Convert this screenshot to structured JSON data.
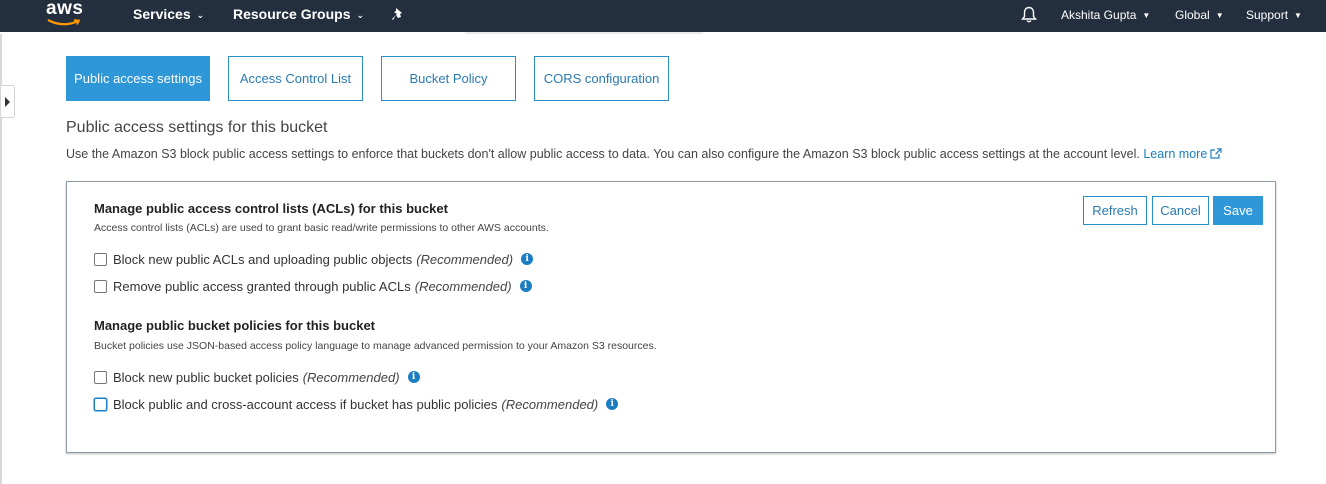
{
  "topnav": {
    "logo_text": "aws",
    "services_label": "Services",
    "resource_groups_label": "Resource Groups",
    "user_label": "Akshita Gupta",
    "region_label": "Global",
    "support_label": "Support",
    "icons": {
      "pin": "pin-icon",
      "bell": "bell-icon",
      "caret": "chevron-down-icon"
    },
    "background_color": "#232f3e"
  },
  "tabs": [
    {
      "label": "Public access settings",
      "active": true
    },
    {
      "label": "Access Control List",
      "active": false
    },
    {
      "label": "Bucket Policy",
      "active": false
    },
    {
      "label": "CORS configuration",
      "active": false
    }
  ],
  "main": {
    "title": "Public access settings for this bucket",
    "description": "Use the Amazon S3 block public access settings to enforce that buckets don't allow public access to data. You can also configure the Amazon S3 block public access settings at the account level.",
    "learn_more_label": "Learn more"
  },
  "panel": {
    "buttons": {
      "refresh": "Refresh",
      "cancel": "Cancel",
      "save": "Save"
    },
    "acl_group": {
      "title": "Manage public access control lists (ACLs) for this bucket",
      "description": "Access control lists (ACLs) are used to grant basic read/write permissions to other AWS accounts.",
      "options": [
        {
          "label": "Block new public ACLs and uploading public objects",
          "note": "(Recommended)",
          "checked": false
        },
        {
          "label": "Remove public access granted through public ACLs",
          "note": "(Recommended)",
          "checked": false
        }
      ]
    },
    "policy_group": {
      "title": "Manage public bucket policies for this bucket",
      "description": "Bucket policies use JSON-based access policy language to manage advanced permission to your Amazon S3 resources.",
      "options": [
        {
          "label": "Block new public bucket policies",
          "note": "(Recommended)",
          "checked": false
        },
        {
          "label": "Block public and cross-account access if bucket has public policies",
          "note": "(Recommended)",
          "checked": false
        }
      ]
    },
    "info_icon_glyph": "i"
  },
  "colors": {
    "accent": "#2d97d8",
    "link": "#1a7fc1"
  }
}
